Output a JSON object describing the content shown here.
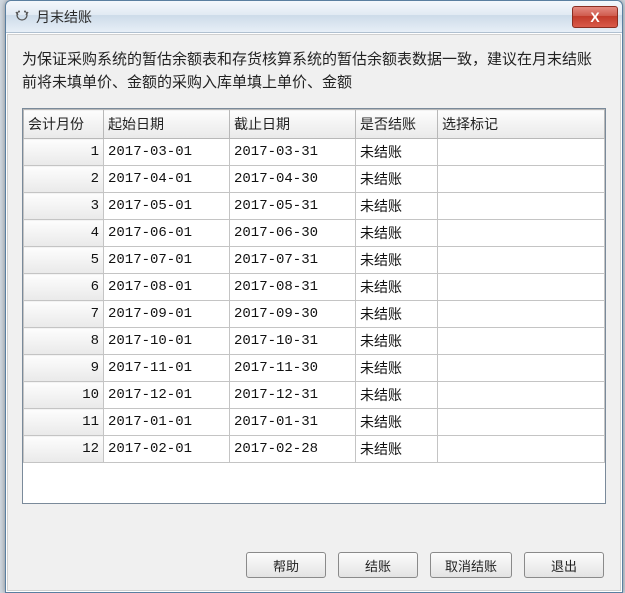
{
  "window": {
    "title": "月末结账",
    "close_symbol": "X"
  },
  "info_text": "为保证采购系统的暂估余额表和存货核算系统的暂估余额表数据一致，建议在月末结账前将未填单价、金额的采购入库单填上单价、金额",
  "columns": {
    "month": "会计月份",
    "start": "起始日期",
    "end": "截止日期",
    "closed": "是否结账",
    "mark": "选择标记"
  },
  "rows": [
    {
      "month": "1",
      "start": "2017-03-01",
      "end": "2017-03-31",
      "closed": "未结账",
      "mark": ""
    },
    {
      "month": "2",
      "start": "2017-04-01",
      "end": "2017-04-30",
      "closed": "未结账",
      "mark": ""
    },
    {
      "month": "3",
      "start": "2017-05-01",
      "end": "2017-05-31",
      "closed": "未结账",
      "mark": ""
    },
    {
      "month": "4",
      "start": "2017-06-01",
      "end": "2017-06-30",
      "closed": "未结账",
      "mark": ""
    },
    {
      "month": "5",
      "start": "2017-07-01",
      "end": "2017-07-31",
      "closed": "未结账",
      "mark": ""
    },
    {
      "month": "6",
      "start": "2017-08-01",
      "end": "2017-08-31",
      "closed": "未结账",
      "mark": ""
    },
    {
      "month": "7",
      "start": "2017-09-01",
      "end": "2017-09-30",
      "closed": "未结账",
      "mark": ""
    },
    {
      "month": "8",
      "start": "2017-10-01",
      "end": "2017-10-31",
      "closed": "未结账",
      "mark": ""
    },
    {
      "month": "9",
      "start": "2017-11-01",
      "end": "2017-11-30",
      "closed": "未结账",
      "mark": ""
    },
    {
      "month": "10",
      "start": "2017-12-01",
      "end": "2017-12-31",
      "closed": "未结账",
      "mark": ""
    },
    {
      "month": "11",
      "start": "2017-01-01",
      "end": "2017-01-31",
      "closed": "未结账",
      "mark": ""
    },
    {
      "month": "12",
      "start": "2017-02-01",
      "end": "2017-02-28",
      "closed": "未结账",
      "mark": ""
    }
  ],
  "buttons": {
    "help": "帮助",
    "close_month": "结账",
    "cancel_close": "取消结账",
    "exit": "退出"
  }
}
